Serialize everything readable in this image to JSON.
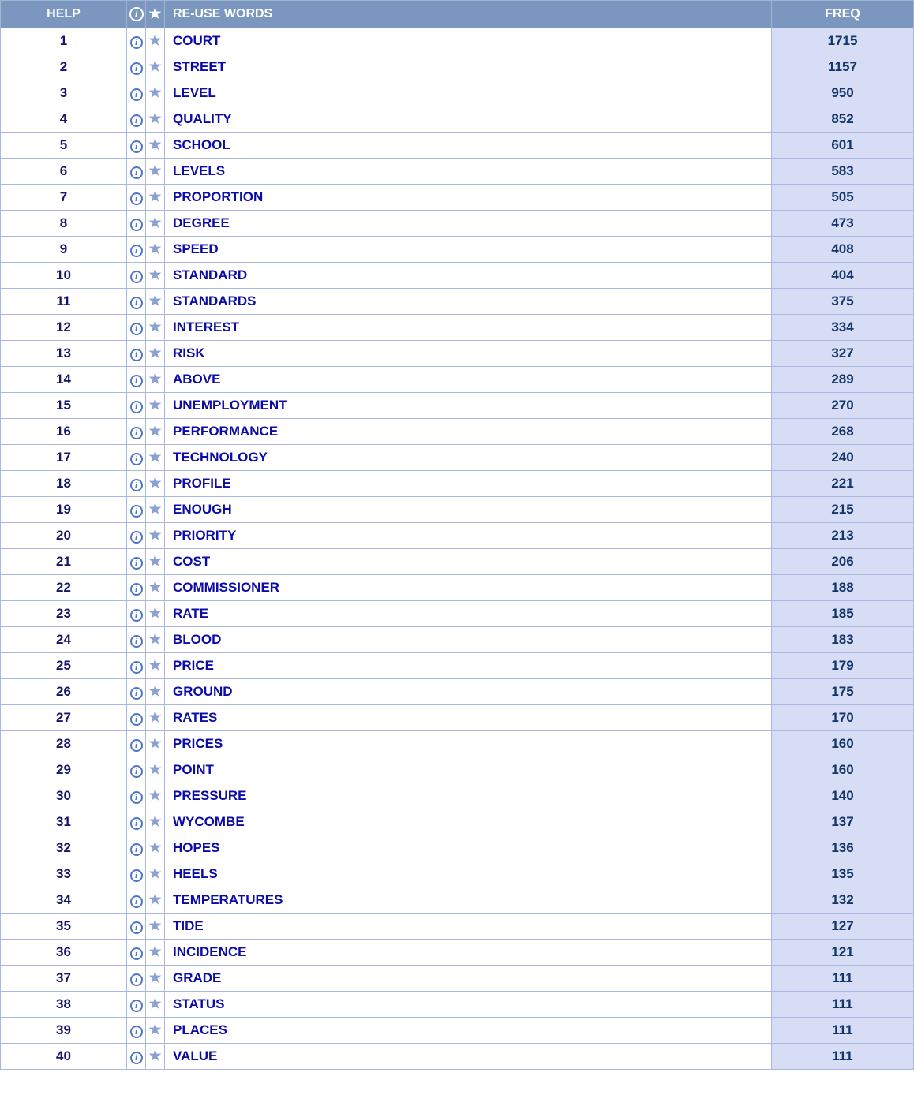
{
  "headers": {
    "help": "HELP",
    "word": "RE-USE WORDS",
    "freq": "FREQ"
  },
  "rows": [
    {
      "n": 1,
      "word": "COURT",
      "freq": 1715
    },
    {
      "n": 2,
      "word": "STREET",
      "freq": 1157
    },
    {
      "n": 3,
      "word": "LEVEL",
      "freq": 950
    },
    {
      "n": 4,
      "word": "QUALITY",
      "freq": 852
    },
    {
      "n": 5,
      "word": "SCHOOL",
      "freq": 601
    },
    {
      "n": 6,
      "word": "LEVELS",
      "freq": 583
    },
    {
      "n": 7,
      "word": "PROPORTION",
      "freq": 505
    },
    {
      "n": 8,
      "word": "DEGREE",
      "freq": 473
    },
    {
      "n": 9,
      "word": "SPEED",
      "freq": 408
    },
    {
      "n": 10,
      "word": "STANDARD",
      "freq": 404
    },
    {
      "n": 11,
      "word": "STANDARDS",
      "freq": 375
    },
    {
      "n": 12,
      "word": "INTEREST",
      "freq": 334
    },
    {
      "n": 13,
      "word": "RISK",
      "freq": 327
    },
    {
      "n": 14,
      "word": "ABOVE",
      "freq": 289
    },
    {
      "n": 15,
      "word": "UNEMPLOYMENT",
      "freq": 270
    },
    {
      "n": 16,
      "word": "PERFORMANCE",
      "freq": 268
    },
    {
      "n": 17,
      "word": "TECHNOLOGY",
      "freq": 240
    },
    {
      "n": 18,
      "word": "PROFILE",
      "freq": 221
    },
    {
      "n": 19,
      "word": "ENOUGH",
      "freq": 215
    },
    {
      "n": 20,
      "word": "PRIORITY",
      "freq": 213
    },
    {
      "n": 21,
      "word": "COST",
      "freq": 206
    },
    {
      "n": 22,
      "word": "COMMISSIONER",
      "freq": 188
    },
    {
      "n": 23,
      "word": "RATE",
      "freq": 185
    },
    {
      "n": 24,
      "word": "BLOOD",
      "freq": 183
    },
    {
      "n": 25,
      "word": "PRICE",
      "freq": 179
    },
    {
      "n": 26,
      "word": "GROUND",
      "freq": 175
    },
    {
      "n": 27,
      "word": "RATES",
      "freq": 170
    },
    {
      "n": 28,
      "word": "PRICES",
      "freq": 160
    },
    {
      "n": 29,
      "word": "POINT",
      "freq": 160
    },
    {
      "n": 30,
      "word": "PRESSURE",
      "freq": 140
    },
    {
      "n": 31,
      "word": "WYCOMBE",
      "freq": 137
    },
    {
      "n": 32,
      "word": "HOPES",
      "freq": 136
    },
    {
      "n": 33,
      "word": "HEELS",
      "freq": 135
    },
    {
      "n": 34,
      "word": "TEMPERATURES",
      "freq": 132
    },
    {
      "n": 35,
      "word": "TIDE",
      "freq": 127
    },
    {
      "n": 36,
      "word": "INCIDENCE",
      "freq": 121
    },
    {
      "n": 37,
      "word": "GRADE",
      "freq": 111
    },
    {
      "n": 38,
      "word": "STATUS",
      "freq": 111
    },
    {
      "n": 39,
      "word": "PLACES",
      "freq": 111
    },
    {
      "n": 40,
      "word": "VALUE",
      "freq": 111
    }
  ]
}
